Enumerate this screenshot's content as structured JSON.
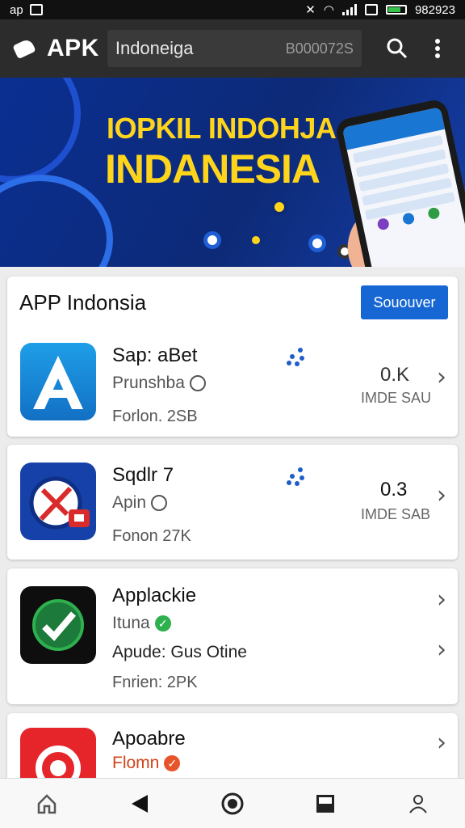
{
  "status_bar": {
    "left_text": "ap",
    "time": "982923"
  },
  "app_bar": {
    "title": "APK",
    "search_query": "Indoneiga",
    "search_code": "B000072S"
  },
  "banner": {
    "line1": "IOPKIL INDOHJA",
    "line2": "INDANESIA"
  },
  "section": {
    "title": "APP Indonsia",
    "button_label": "Sououver"
  },
  "apps": [
    {
      "name": "Sap: aBet",
      "subtitle": "Prunshba",
      "meta": "Forlon. 2SB",
      "size": "0.K",
      "downloads": "IMDE SAU"
    },
    {
      "name": "Sqdlr 7",
      "subtitle": "Apin",
      "meta": "Fonon 27K",
      "size": "0.3",
      "downloads": "IMDE SAB"
    },
    {
      "name": "Applackie",
      "subtitle": "Ituna",
      "meta": "Apude: Gus Otine",
      "meta2": "Fnrien: 2PK"
    },
    {
      "name": "Apoabre",
      "subtitle": "Flomn"
    }
  ],
  "colors": {
    "accent": "#1667d4",
    "appbar": "#2c2c2c",
    "banner_text": "#ffd51c",
    "banner_bg": "#0d2a77"
  },
  "nav_icons": [
    "home-icon",
    "back-icon",
    "record-icon",
    "inbox-icon",
    "profile-icon"
  ]
}
